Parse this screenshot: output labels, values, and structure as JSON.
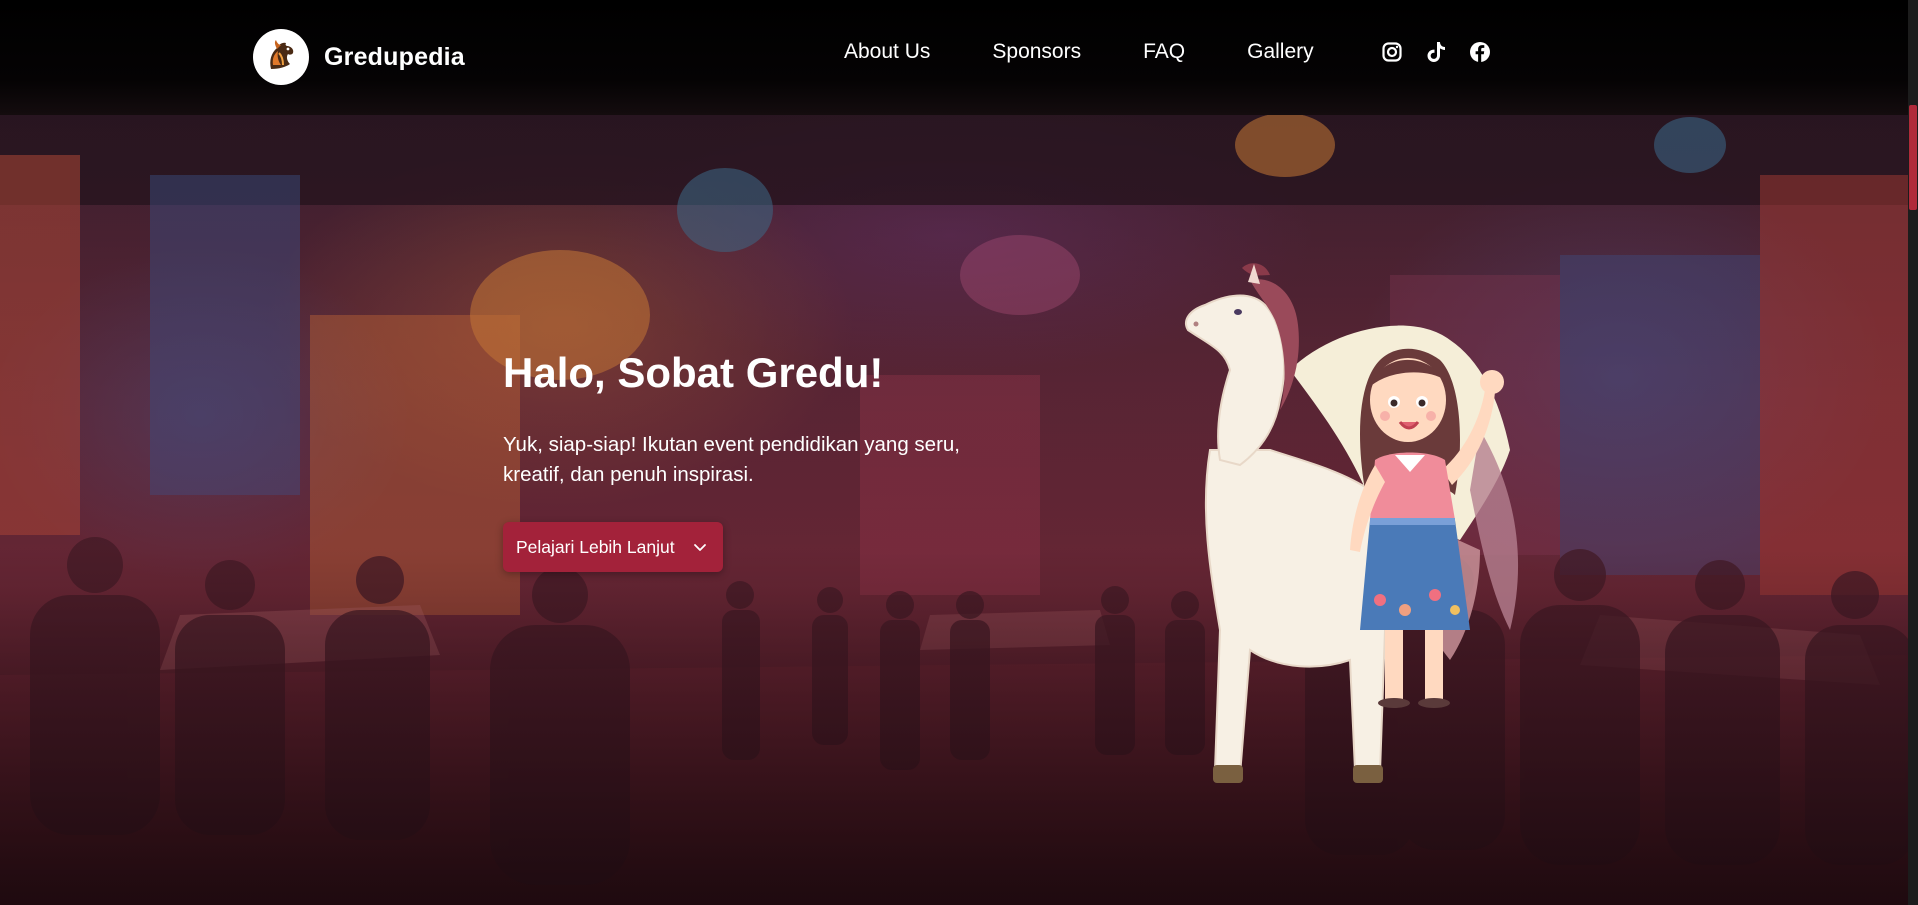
{
  "brand": {
    "name": "Gredupedia",
    "logo_icon": "horse-head-logo-icon"
  },
  "nav": {
    "items": [
      {
        "label": "About Us"
      },
      {
        "label": "Sponsors"
      },
      {
        "label": "FAQ"
      },
      {
        "label": "Gallery"
      }
    ],
    "socials": [
      {
        "name": "instagram-icon"
      },
      {
        "name": "tiktok-icon"
      },
      {
        "name": "facebook-icon"
      }
    ]
  },
  "hero": {
    "title": "Halo, Sobat Gredu!",
    "subtitle": "Yuk, siap-siap! Ikutan event pendidikan yang seru, kreatif, dan penuh inspirasi.",
    "cta_label": "Pelajari Lebih Lanjut",
    "cta_icon": "chevron-down-icon",
    "illustration": "pegasus-and-girl-mascot"
  },
  "colors": {
    "accent": "#a3223a",
    "navbar_bg": "#000000",
    "text": "#ffffff"
  }
}
